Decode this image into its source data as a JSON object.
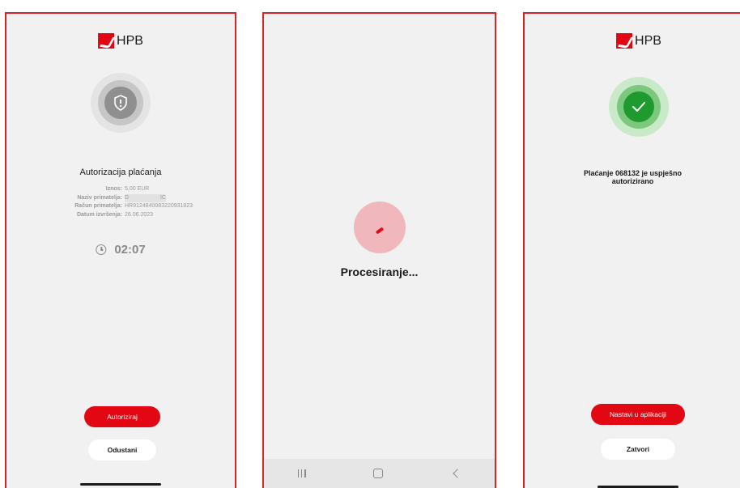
{
  "screen1": {
    "logo_text": "HPB",
    "title": "Autorizacija plaćanja",
    "details": [
      {
        "label": "Iznos:",
        "value": "5,00 EUR"
      },
      {
        "label": "Naziv primatelja:",
        "value": "D                    IC"
      },
      {
        "label": "Račun primatelja:",
        "value": "HR9124840083220931823"
      },
      {
        "label": "Datum izvršenja:",
        "value": "26.06.2023"
      }
    ],
    "timer": "02:07",
    "authorize_label": "Autoriziraj",
    "cancel_label": "Odustani"
  },
  "screen2": {
    "processing_text": "Procesiranje..."
  },
  "screen3": {
    "logo_text": "HPB",
    "success_line1": "Plaćanje 068132 je uspješno",
    "success_line2": "autorizirano",
    "continue_label": "Nastavi u aplikaciji",
    "close_label": "Zatvori"
  },
  "colors": {
    "brand_red": "#e30613",
    "success_green": "#1f9a2e",
    "frame_border": "#d8232a"
  }
}
